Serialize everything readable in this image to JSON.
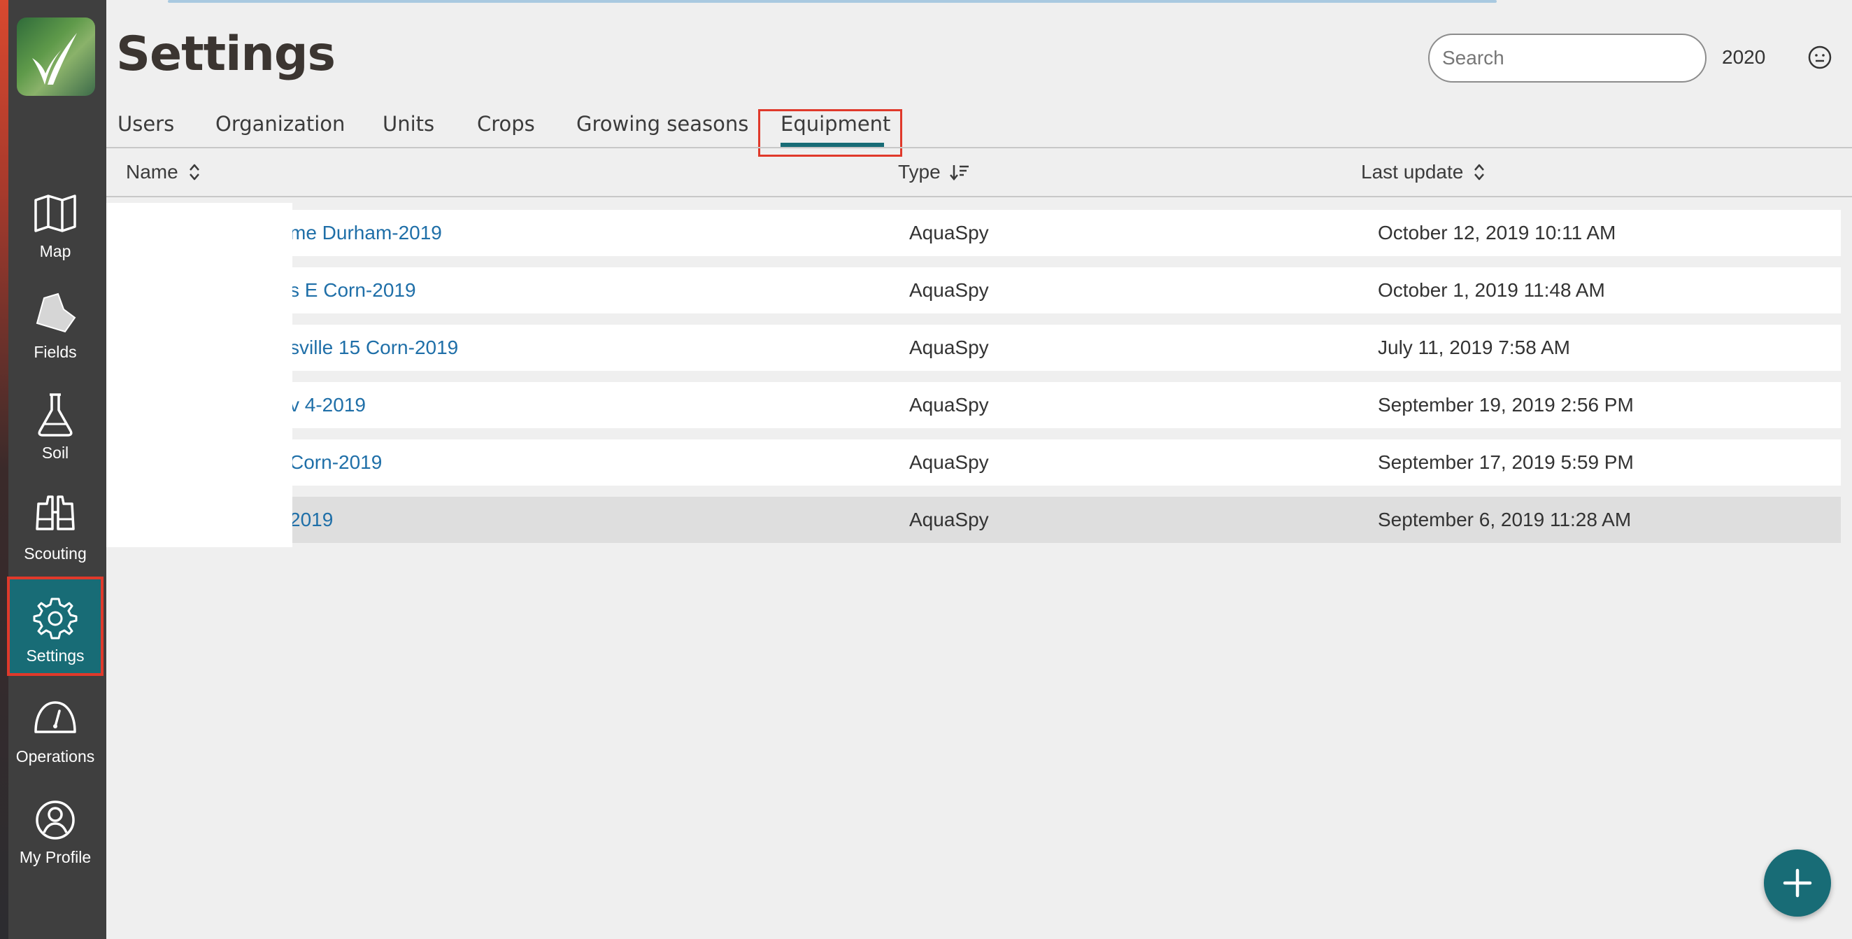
{
  "header": {
    "title": "Settings",
    "search_placeholder": "Search",
    "year": "2020"
  },
  "sidebar": {
    "items": [
      {
        "label": "Map",
        "icon": "map-icon"
      },
      {
        "label": "Fields",
        "icon": "field-icon"
      },
      {
        "label": "Soil",
        "icon": "flask-icon"
      },
      {
        "label": "Scouting",
        "icon": "binoculars-icon"
      },
      {
        "label": "Settings",
        "icon": "gear-icon",
        "active": true
      },
      {
        "label": "Operations",
        "icon": "gauge-icon"
      },
      {
        "label": "My Profile",
        "icon": "user-icon"
      }
    ]
  },
  "tabs": [
    {
      "label": "Users"
    },
    {
      "label": "Organization"
    },
    {
      "label": "Units"
    },
    {
      "label": "Crops"
    },
    {
      "label": "Growing seasons"
    },
    {
      "label": "Equipment",
      "active": true
    }
  ],
  "table": {
    "columns": [
      {
        "label": "Name",
        "sort": "unsorted"
      },
      {
        "label": "Type",
        "sort": "descending"
      },
      {
        "label": "Last update",
        "sort": "unsorted"
      }
    ],
    "rows": [
      {
        "name": "me Durham-2019",
        "type": "AquaSpy",
        "updated": "October 12, 2019 10:11 AM"
      },
      {
        "name": "s E Corn-2019",
        "type": "AquaSpy",
        "updated": "October 1, 2019 11:48 AM"
      },
      {
        "name": "sville 15 Corn-2019",
        "type": "AquaSpy",
        "updated": "July 11, 2019 7:58 AM"
      },
      {
        "name": "v 4-2019",
        "type": "AquaSpy",
        "updated": "September 19, 2019 2:56 PM"
      },
      {
        "name": "Corn-2019",
        "type": "AquaSpy",
        "updated": "September 17, 2019 5:59 PM"
      },
      {
        "name": "2019",
        "type": "AquaSpy",
        "updated": "September 6, 2019 11:28 AM",
        "selected": true
      }
    ]
  },
  "colors": {
    "accent": "#186c76",
    "highlight": "#e0392b",
    "link": "#1f6fa8",
    "sidebar": "#3f3f3f"
  }
}
